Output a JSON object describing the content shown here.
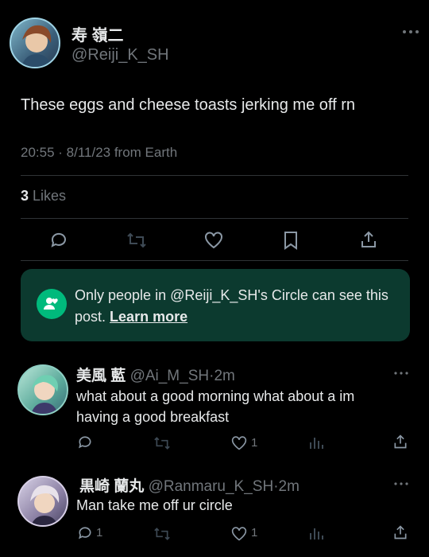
{
  "post": {
    "display_name": "寿 嶺二",
    "handle": "@Reiji_K_SH",
    "text": "These eggs and cheese toasts jerking me off rn",
    "meta": "20:55 · 8/11/23 from Earth",
    "likes_count": "3",
    "likes_label": "Likes",
    "more_icon": "more-horizontal-icon"
  },
  "circle_notice": {
    "text": "Only people in @Reiji_K_SH's Circle can see this post.",
    "link": "Learn more",
    "icon": "circle-people-icon",
    "accent": "#00ba7c"
  },
  "replies": [
    {
      "display_name": "美風 藍",
      "handle": "@Ai_M_SH",
      "time": "2m",
      "text_line1": "what about a good morning what about a im",
      "text_line2": "having a good breakfast",
      "reply_count": "",
      "like_count": "1"
    },
    {
      "display_name": "黒崎 蘭丸",
      "handle": "@Ranmaru_K_SH",
      "time": "2m",
      "text_line1": "Man take me off ur circle",
      "reply_count": "1",
      "like_count": "1"
    }
  ],
  "colors": {
    "background": "#000000",
    "text": "#e7e9ea",
    "muted": "#71767b",
    "circle_bg": "#0c3a2f",
    "link": "#e7e9ea"
  }
}
